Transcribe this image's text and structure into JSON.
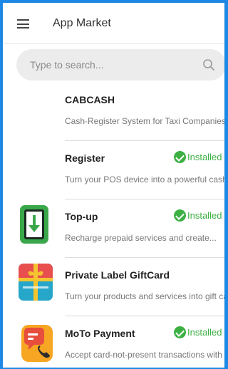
{
  "header": {
    "title": "App Market",
    "menu_icon": "hamburger-menu-icon"
  },
  "search": {
    "placeholder": "Type to search...",
    "icon": "search-icon"
  },
  "colors": {
    "frame_border": "#1e88e5",
    "installed": "#3cb043"
  },
  "apps": [
    {
      "name": "CABCASH",
      "description": "Cash-Register System for Taxi Companies",
      "status": "",
      "icon": ""
    },
    {
      "name": "Register",
      "description": "Turn your POS device into a powerful cash register",
      "status": "Installed",
      "icon": ""
    },
    {
      "name": "Top-up",
      "description": "Recharge prepaid services and create...",
      "status": "Installed",
      "icon": "phone-download-icon"
    },
    {
      "name": "Private Label GiftCard",
      "description": "Turn your products and services into gift cards",
      "status": "",
      "icon": "gift-card-icon"
    },
    {
      "name": "MoTo Payment",
      "description": "Accept card-not-present transactions with",
      "status": "Installed",
      "icon": "phone-call-card-icon"
    }
  ]
}
